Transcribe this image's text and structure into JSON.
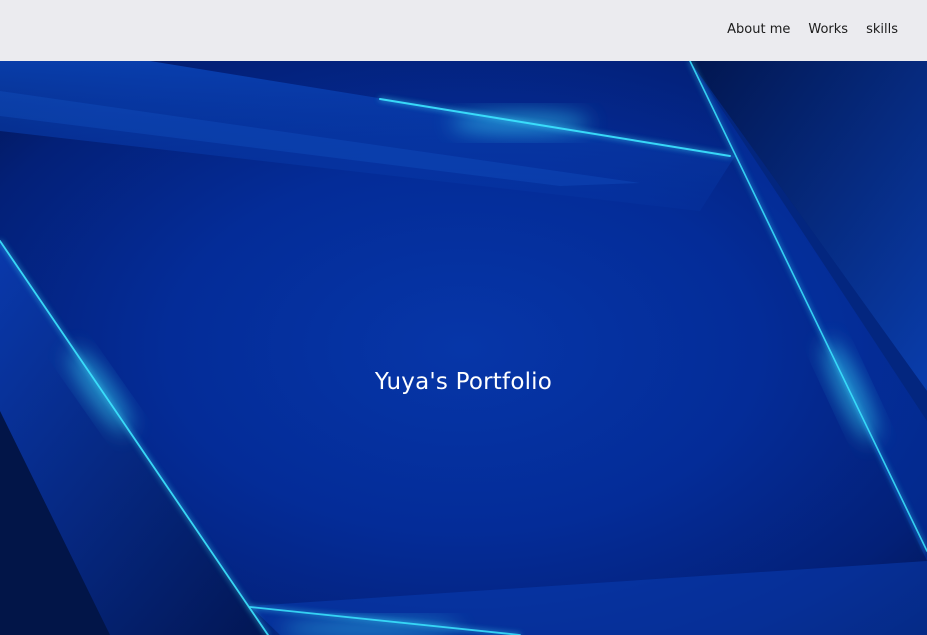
{
  "header": {
    "nav": {
      "about": "About me",
      "works": "Works",
      "skills": "skills"
    }
  },
  "hero": {
    "title": "Yuya's Portfolio"
  },
  "colors": {
    "header_bg": "#ebebef",
    "hero_blue": "#042c98",
    "glow_cyan": "#3de6ff",
    "nav_text": "#1b1b1b",
    "title_text": "#ffffff"
  }
}
